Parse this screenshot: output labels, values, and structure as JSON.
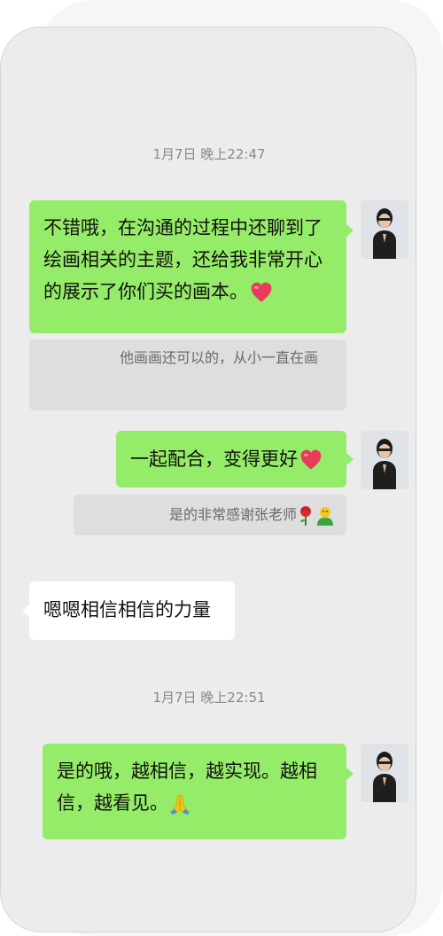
{
  "chat": {
    "timestamps": [
      "1月7日 晚上22:47",
      "1月7日 晚上22:51"
    ],
    "messages": [
      {
        "text": "不错哦，在沟通的过程中还聊到了绘画相关的主题，还给我非常开心的展示了你们买的画本。"
      },
      {
        "text": "一起配合，变得更好"
      },
      {
        "text": "嗯嗯相信相信的力量"
      },
      {
        "text": "是的哦，越相信，越实现。越相信，越看见。"
      }
    ],
    "quotes": [
      {
        "text": "他画画还可以的，从小一直在画"
      },
      {
        "text": "是的非常感谢张老师"
      }
    ],
    "emoji": {
      "msg1": "heart-icon",
      "msg2": "heart-icon",
      "quote2": [
        "rose-icon",
        "person-icon"
      ],
      "msg4": "folded-hands-icon"
    }
  }
}
